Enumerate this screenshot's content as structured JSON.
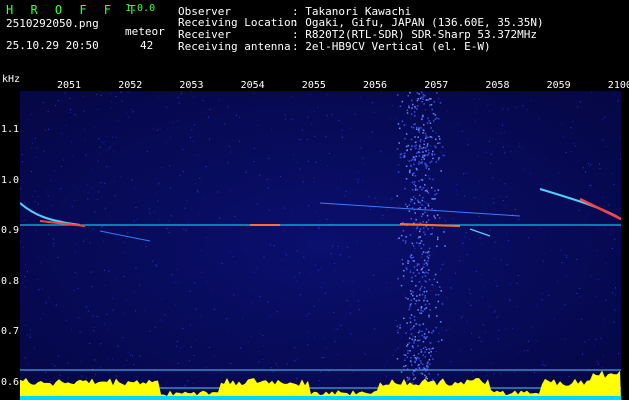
{
  "app": {
    "name": "H R O F F T",
    "version": "1.0.0"
  },
  "file": {
    "name": "2510292050.png",
    "datetime": "25.10.29 20:50"
  },
  "meteor": {
    "label": "meteor",
    "count": "42"
  },
  "info": [
    {
      "key": "Observer",
      "value": ": Takanori Kawachi"
    },
    {
      "key": "Receiving Location",
      "value": ": Ogaki, Gifu, JAPAN (136.60E, 35.35N)"
    },
    {
      "key": "Receiver",
      "value": ": R820T2(RTL-SDR) SDR-Sharp 53.372MHz"
    },
    {
      "key": "Receiving antenna",
      "value": ": 2el-HB9CV Vertical (el. E-W)"
    }
  ],
  "axis": {
    "unit": "kHz",
    "x_ticks": [
      "2051",
      "2052",
      "2053",
      "2054",
      "2055",
      "2056",
      "2057",
      "2058",
      "2059",
      "2100"
    ],
    "y_ticks": [
      "1.1",
      "1.0",
      "0.9",
      "0.8",
      "0.7",
      "0.6"
    ],
    "y_values": [
      1.1,
      1.0,
      0.9,
      0.8,
      0.7,
      0.6
    ]
  },
  "colors": {
    "background": "#060948",
    "accent": "#3cff3c",
    "baseline": "#ffff00",
    "signal": "#00e5ff"
  }
}
